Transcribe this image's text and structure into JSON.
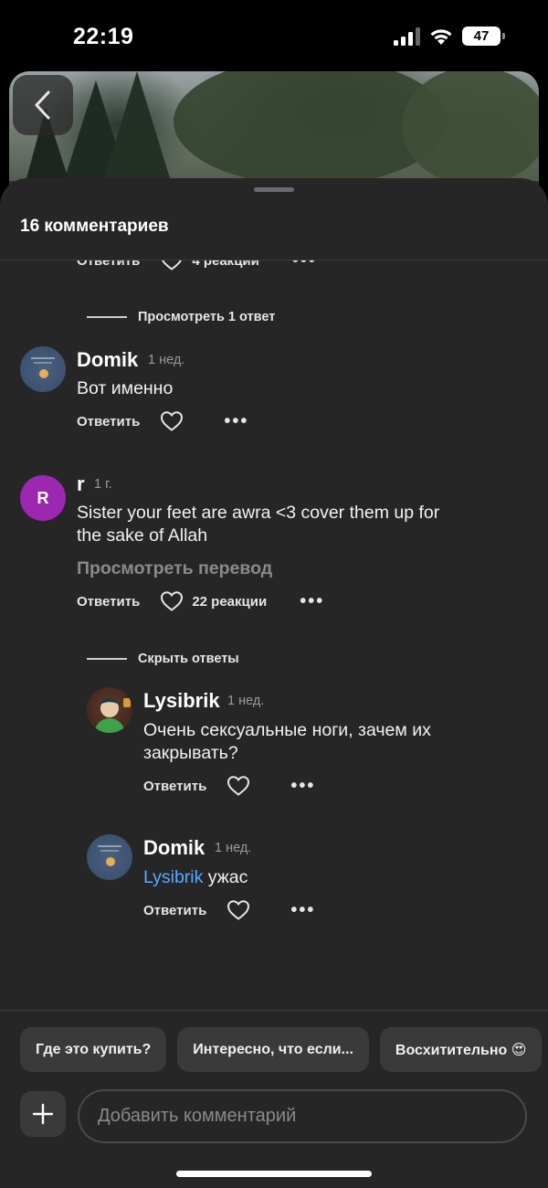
{
  "status_bar": {
    "time": "22:19",
    "battery": "47"
  },
  "sheet": {
    "title": "16 комментариев"
  },
  "top_partial": {
    "reply_label": "Ответить",
    "reactions": "4 реакции",
    "view_replies": "Просмотреть 1 ответ"
  },
  "comments": [
    {
      "username": "Domik",
      "time": "1 нед.",
      "text": "Вот именно",
      "reply_label": "Ответить"
    },
    {
      "username": "r",
      "avatar_letter": "R",
      "avatar_color": "#9c27b0",
      "time": "1 г.",
      "text_line1": "Sister your feet are awra <3 cover them up for",
      "text_line2": "the sake of Allah",
      "translate": "Просмотреть перевод",
      "reply_label": "Ответить",
      "reactions": "22 реакции",
      "hide_replies": "Скрыть ответы"
    }
  ],
  "replies": [
    {
      "username": "Lysibrik",
      "time": "1 нед.",
      "text_line1": "Очень сексуальные ноги, зачем их",
      "text_line2": "закрывать?",
      "reply_label": "Ответить"
    },
    {
      "username": "Domik",
      "time": "1 нед.",
      "mention": "Lysibrik",
      "text": " ужас",
      "reply_label": "Ответить"
    }
  ],
  "suggestions": [
    "Где это купить?",
    "Интересно, что если...",
    "Восхитительно 😍"
  ],
  "input": {
    "placeholder": "Добавить комментарий"
  },
  "colors": {
    "sheet_bg": "#262626",
    "chip_bg": "#3a3a3a",
    "mention": "#5aa8ff",
    "muted": "#9a9a9a"
  }
}
